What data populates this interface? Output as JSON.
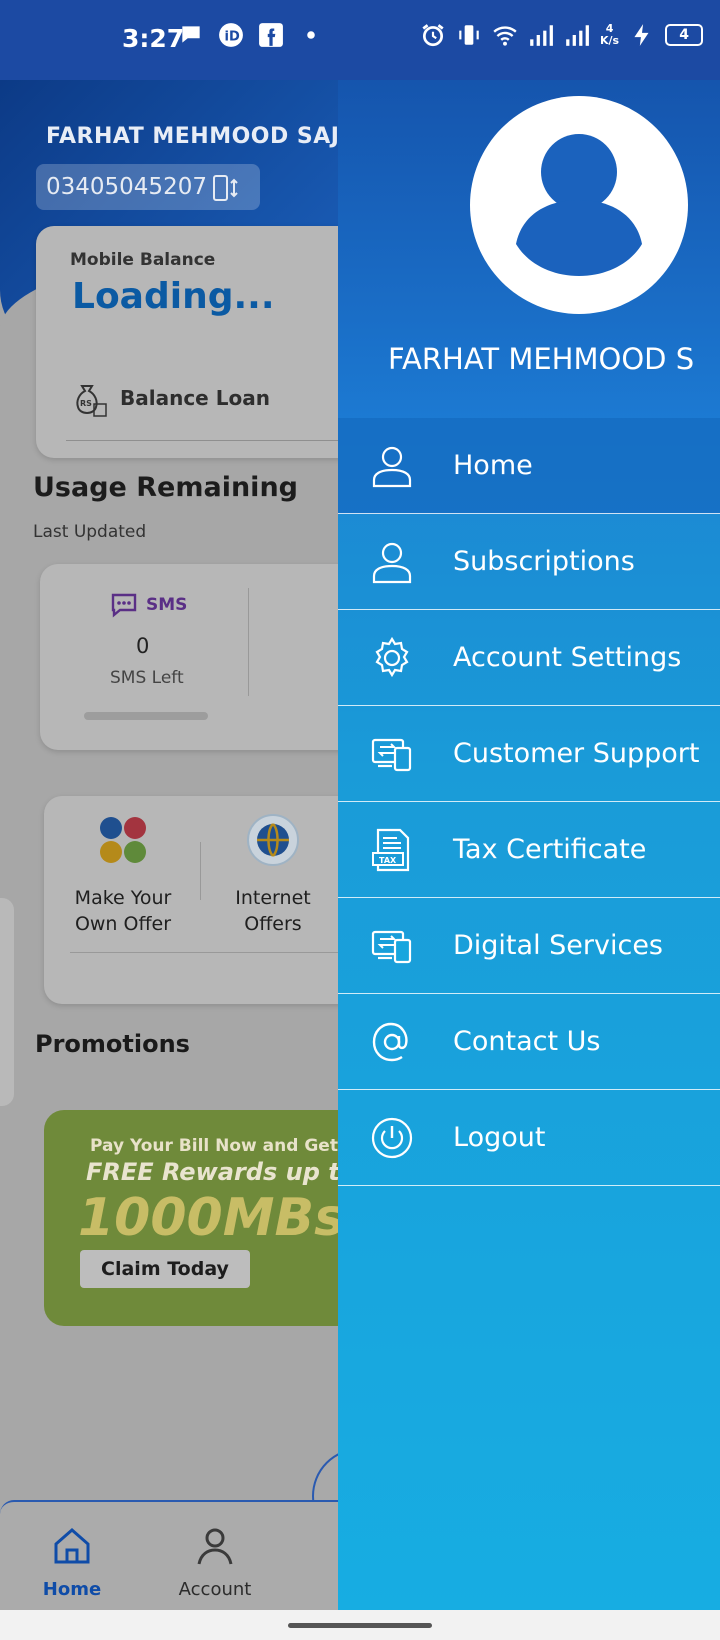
{
  "status_bar": {
    "time": "3:27",
    "net_speed_top": "4",
    "net_speed_unit": "K/s",
    "battery": "4"
  },
  "background": {
    "subscriber_name": "FARHAT MEHMOOD SAJID",
    "phone_number": "03405045207",
    "balance": {
      "label": "Mobile Balance",
      "value": "Loading...",
      "loan_label": "Balance Loan"
    },
    "usage": {
      "title": "Usage Remaining",
      "subtitle": "Last Updated",
      "sms_label": "SMS",
      "sms_count": "0",
      "sms_left_label": "SMS Left"
    },
    "offers": [
      {
        "label_line1": "Make Your",
        "label_line2": "Own Offer"
      },
      {
        "label_line1": "Internet",
        "label_line2": "Offers"
      }
    ],
    "promotions": {
      "title": "Promotions",
      "banner_line1": "Pay Your Bill Now and Get",
      "banner_line2": "FREE Rewards up to",
      "banner_line3": "1000MBs",
      "banner_button": "Claim Today"
    },
    "bottom_nav": [
      {
        "label": "Home",
        "icon": "home-icon"
      },
      {
        "label": "Account",
        "icon": "person-icon"
      }
    ]
  },
  "drawer": {
    "user_name": "FARHAT MEHMOOD S",
    "items": [
      {
        "label": "Home",
        "icon": "person-outline-icon",
        "active": true
      },
      {
        "label": "Subscriptions",
        "icon": "person-outline-icon",
        "active": false
      },
      {
        "label": "Account Settings",
        "icon": "gear-icon",
        "active": false
      },
      {
        "label": "Customer Support",
        "icon": "support-devices-icon",
        "active": false
      },
      {
        "label": "Tax Certificate",
        "icon": "tax-document-icon",
        "active": false
      },
      {
        "label": "Digital Services",
        "icon": "support-devices-icon",
        "active": false
      },
      {
        "label": "Contact Us",
        "icon": "at-sign-icon",
        "active": false
      },
      {
        "label": "Logout",
        "icon": "power-icon",
        "active": false
      }
    ]
  },
  "colors": {
    "status_bar": "#1c4aa3",
    "drawer_gradient_top": "#1e6fcc",
    "drawer_gradient_bottom": "#17ade2",
    "brand_blue": "#0b5aa3"
  }
}
